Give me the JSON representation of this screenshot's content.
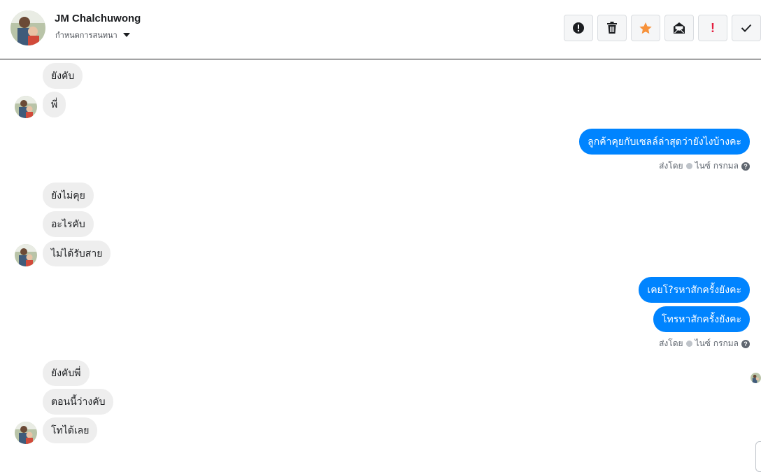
{
  "header": {
    "contact_name": "JM Chalchuwong",
    "subtitle": "กำหนดการสนทนา",
    "toolbar": [
      {
        "name": "report-button",
        "icon": "alert-circle-icon"
      },
      {
        "name": "delete-button",
        "icon": "trash-icon"
      },
      {
        "name": "star-button",
        "icon": "star-icon"
      },
      {
        "name": "mark-unread-button",
        "icon": "open-envelope-icon"
      },
      {
        "name": "spam-button",
        "icon": "exclamation-icon",
        "text": "!"
      },
      {
        "name": "done-button",
        "icon": "check-icon"
      }
    ]
  },
  "messages": {
    "m1": "ยังคับ",
    "m2": "พี่",
    "m3": "ลูกค้าคุยกับเซลล์ล่าสุดว่ายังไงบ้างคะ",
    "m4": "ยังไม่คุย",
    "m5": "อะไรคับ",
    "m6": "ไม่ได้รับสาย",
    "m7": "เคยโ?รหาสักครั้งยังคะ",
    "m8": "โทรหาสักครั้งยังคะ",
    "m9": "ยังคับพี่",
    "m10": "ตอนนี้ว่างคับ",
    "m11": "โทได้เลย"
  },
  "sent_by": {
    "label": "ส่งโดย",
    "sender": "ไนซ์ กรกมล",
    "help": "?"
  },
  "colors": {
    "outgoing": "#0084ff",
    "incoming": "#eeeeee",
    "star": "#f7923b",
    "spam": "#e41e3f"
  }
}
